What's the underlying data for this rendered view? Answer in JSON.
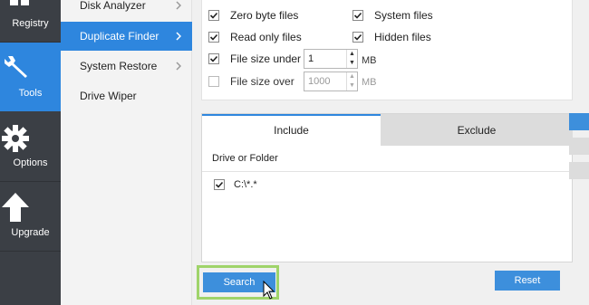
{
  "nav": {
    "items": [
      {
        "label": "Registry",
        "icon": "registry-icon",
        "active": false
      },
      {
        "label": "Tools",
        "icon": "wrench-icon",
        "active": true
      },
      {
        "label": "Options",
        "icon": "gear-icon",
        "active": false
      },
      {
        "label": "Upgrade",
        "icon": "upload-arrow-icon",
        "active": false
      }
    ]
  },
  "subnav": {
    "items": [
      {
        "label": "Disk Analyzer",
        "active": false
      },
      {
        "label": "Duplicate Finder",
        "active": true
      },
      {
        "label": "System Restore",
        "active": false
      },
      {
        "label": "Drive Wiper",
        "active": false
      }
    ]
  },
  "options": {
    "zero_byte": {
      "label": "Zero byte files",
      "checked": true
    },
    "system_files": {
      "label": "System files",
      "checked": true
    },
    "read_only": {
      "label": "Read only files",
      "checked": true
    },
    "hidden_files": {
      "label": "Hidden files",
      "checked": true
    },
    "size_under": {
      "label": "File size under",
      "checked": true,
      "value": "1",
      "unit": "MB"
    },
    "size_over": {
      "label": "File size over",
      "checked": false,
      "value": "1000",
      "unit": "MB"
    }
  },
  "tabs": {
    "include": "Include",
    "exclude": "Exclude"
  },
  "list": {
    "column_header": "Drive or Folder",
    "rows": [
      {
        "path": "C:\\*.*",
        "checked": true
      }
    ]
  },
  "buttons": {
    "search": "Search",
    "reset": "Reset"
  },
  "colors": {
    "accent": "#2e86de",
    "nav_bg": "#3b3f45",
    "highlight": "#9fd46a"
  }
}
